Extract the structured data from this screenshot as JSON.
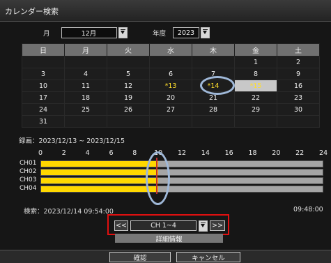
{
  "window": {
    "title": "カレンダー検索"
  },
  "selectors": {
    "month_label": "月",
    "month_value": "12月",
    "year_label": "年度",
    "year_value": "2023"
  },
  "calendar": {
    "weekdays": [
      "日",
      "月",
      "火",
      "水",
      "木",
      "金",
      "土"
    ],
    "weeks": [
      [
        "",
        "",
        "",
        "",
        "",
        "1",
        "2"
      ],
      [
        "3",
        "4",
        "5",
        "6",
        "7",
        "8",
        "9"
      ],
      [
        "10",
        "11",
        "12",
        "*13",
        "*14",
        "*15",
        "16"
      ],
      [
        "17",
        "18",
        "19",
        "20",
        "21",
        "22",
        "23"
      ],
      [
        "24",
        "25",
        "26",
        "27",
        "28",
        "29",
        "30"
      ],
      [
        "31",
        "",
        "",
        "",
        "",
        "",
        ""
      ]
    ],
    "recorded_days": [
      "*13",
      "*14",
      "*15"
    ],
    "selected_day": "*15"
  },
  "recording": {
    "range_text": "録画：2023/12/13 ~ 2023/12/15"
  },
  "timeline": {
    "hours": [
      "0",
      "2",
      "4",
      "6",
      "8",
      "10",
      "12",
      "14",
      "16",
      "18",
      "20",
      "22",
      "24"
    ],
    "channels": [
      {
        "label": "CH01",
        "recorded_until_hour": 10
      },
      {
        "label": "CH02",
        "recorded_until_hour": 10
      },
      {
        "label": "CH03",
        "recorded_until_hour": 10
      },
      {
        "label": "CH04",
        "recorded_until_hour": 10
      }
    ],
    "cursor_hour": 9.8,
    "search_text": "検索：2023/12/14 09:54:00",
    "end_time": "09:48:00"
  },
  "controls": {
    "prev_label": "<<",
    "next_label": ">>",
    "channel_select": "CH 1~4",
    "detail_label": "詳細情報"
  },
  "footer": {
    "confirm_label": "確認",
    "cancel_label": "キャンセル"
  },
  "colors": {
    "recorded": "#ffd800",
    "highlight_box": "#e21010",
    "annotation_oval": "#9fb8d8"
  }
}
